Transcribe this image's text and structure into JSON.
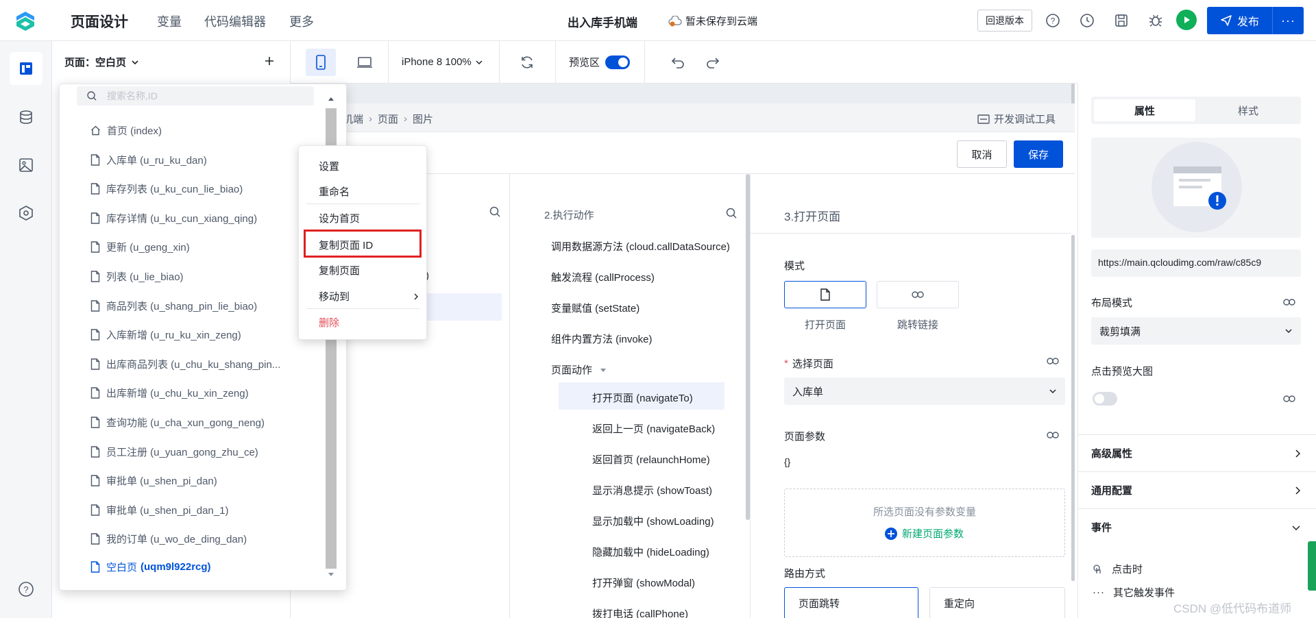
{
  "topbar": {
    "page_title": "页面设计",
    "nav": [
      "变量",
      "代码编辑器",
      "更多"
    ],
    "app_title": "出入库手机端",
    "save_status": "暂未保存到云端",
    "rollback_label": "回退版本",
    "publish_label": "发布",
    "publish_more": "···"
  },
  "page_panel": {
    "header": "页面：空白页",
    "add_icon": "plus-icon",
    "search_placeholder": "搜索名称,ID",
    "pages": [
      {
        "label": "首页 (index)",
        "icon": "home-icon"
      },
      {
        "label": "入库单 (u_ru_ku_dan)",
        "icon": "file-icon"
      },
      {
        "label": "库存列表 (u_ku_cun_lie_biao)",
        "icon": "file-icon"
      },
      {
        "label": "库存详情 (u_ku_cun_xiang_qing)",
        "icon": "file-icon"
      },
      {
        "label": "更新 (u_geng_xin)",
        "icon": "file-icon"
      },
      {
        "label": "列表 (u_lie_biao)",
        "icon": "file-icon"
      },
      {
        "label": "商品列表 (u_shang_pin_lie_biao)",
        "icon": "file-icon"
      },
      {
        "label": "入库新增 (u_ru_ku_xin_zeng)",
        "icon": "file-icon"
      },
      {
        "label": "出库商品列表 (u_chu_ku_shang_pin...",
        "icon": "file-icon"
      },
      {
        "label": "出库新增 (u_chu_ku_xin_zeng)",
        "icon": "file-icon"
      },
      {
        "label": "查询功能 (u_cha_xun_gong_neng)",
        "icon": "file-icon"
      },
      {
        "label": "员工注册 (u_yuan_gong_zhu_ce)",
        "icon": "file-icon"
      },
      {
        "label": "审批单 (u_shen_pi_dan)",
        "icon": "file-icon"
      },
      {
        "label": "审批单 (u_shen_pi_dan_1)",
        "icon": "file-icon"
      },
      {
        "label": "我的订单 (u_wo_de_ding_dan)",
        "icon": "file-icon"
      }
    ],
    "active_page": {
      "name": "空白页",
      "id": "(uqm9l922rcg)"
    }
  },
  "context_menu": {
    "items": [
      "设置",
      "重命名",
      "设为首页",
      "复制页面 ID",
      "复制页面",
      "移动到",
      "删除"
    ],
    "highlighted": "复制页面 ID",
    "danger_color": "#e34d59"
  },
  "toolbar": {
    "device": "iPhone 8 100%",
    "preview_label": "预览区",
    "preview_on": true
  },
  "modal": {
    "breadcrumb": [
      "机端",
      "页面",
      "图片"
    ],
    "dev_tools_label": "开发调试工具",
    "cancel_label": "取消",
    "save_label": "保存",
    "col1_partial": [
      ")",
      "r)"
    ],
    "col2_title": "2.执行动作",
    "actions": [
      "调用数据源方法 (cloud.callDataSource)",
      "触发流程 (callProcess)",
      "变量赋值 (setState)",
      "组件内置方法 (invoke)"
    ],
    "page_actions_label": "页面动作",
    "page_actions": [
      "打开页面 (navigateTo)",
      "返回上一页 (navigateBack)",
      "返回首页 (relaunchHome)",
      "显示消息提示 (showToast)",
      "显示加载中 (showLoading)",
      "隐藏加载中 (hideLoading)",
      "打开弹窗 (showModal)",
      "拨打电话 (callPhone)"
    ],
    "col3_title": "3.打开页面",
    "mode_label": "模式",
    "mode_options": [
      "打开页面",
      "跳转链接"
    ],
    "select_page_label": "选择页面",
    "select_page_value": "入库单",
    "page_params_label": "页面参数",
    "page_params_value": "{}",
    "no_params_text": "所选页面没有参数变量",
    "new_param_label": "新建页面参数",
    "route_label": "路由方式",
    "route_options": [
      "页面跳转",
      "重定向"
    ]
  },
  "right_panel": {
    "tabs": [
      "属性",
      "样式"
    ],
    "active_tab": "属性",
    "image_url": "https://main.qcloudimg.com/raw/c85c9",
    "layout_mode_label": "布局模式",
    "layout_mode_value": "裁剪填满",
    "preview_big_label": "点击预览大图",
    "preview_big_on": false,
    "sections": [
      "高级属性",
      "通用配置",
      "事件"
    ],
    "events": [
      "点击时",
      "其它触发事件"
    ]
  },
  "watermark": "CSDN @低代码布道师",
  "colors": {
    "primary": "#0052d9",
    "success": "#10b05a",
    "green_link": "#00a870",
    "danger": "#e34d59"
  }
}
